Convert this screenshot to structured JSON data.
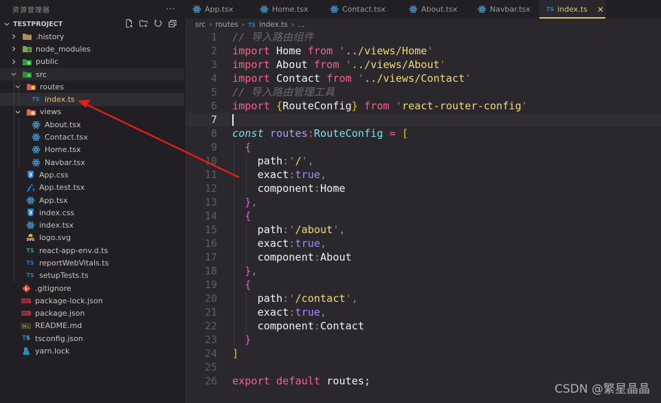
{
  "sidebar": {
    "title": "资源管理器",
    "more_label": "···",
    "project": "TESTPROJECT",
    "actions": [
      "new-file",
      "new-folder",
      "refresh",
      "collapse-all"
    ],
    "items": [
      {
        "label": ".history",
        "type": "folder",
        "icon": "folder-history-icon",
        "expanded": false,
        "depth": 1
      },
      {
        "label": "node_modules",
        "type": "folder",
        "icon": "folder-node-icon",
        "expanded": false,
        "depth": 1
      },
      {
        "label": "public",
        "type": "folder",
        "icon": "folder-public-icon",
        "expanded": false,
        "depth": 1
      },
      {
        "label": "src",
        "type": "folder",
        "icon": "folder-src-icon",
        "expanded": true,
        "depth": 1
      },
      {
        "label": "routes",
        "type": "folder",
        "icon": "folder-routes-icon",
        "expanded": true,
        "depth": 2
      },
      {
        "label": "index.ts",
        "type": "file",
        "icon": "typescript-icon",
        "depth": 3,
        "selected": true
      },
      {
        "label": "views",
        "type": "folder",
        "icon": "folder-views-icon",
        "expanded": true,
        "depth": 2
      },
      {
        "label": "About.tsx",
        "type": "file",
        "icon": "react-icon",
        "depth": 3
      },
      {
        "label": "Contact.tsx",
        "type": "file",
        "icon": "react-icon",
        "depth": 3
      },
      {
        "label": "Home.tsx",
        "type": "file",
        "icon": "react-icon",
        "depth": 3
      },
      {
        "label": "Navbar.tsx",
        "type": "file",
        "icon": "react-icon",
        "depth": 3
      },
      {
        "label": "App.css",
        "type": "file",
        "icon": "css-icon",
        "depth": 2
      },
      {
        "label": "App.test.tsx",
        "type": "file",
        "icon": "test-icon",
        "depth": 2
      },
      {
        "label": "App.tsx",
        "type": "file",
        "icon": "react-icon",
        "depth": 2
      },
      {
        "label": "index.css",
        "type": "file",
        "icon": "css-icon",
        "depth": 2
      },
      {
        "label": "index.tsx",
        "type": "file",
        "icon": "react-icon",
        "depth": 2
      },
      {
        "label": "logo.svg",
        "type": "file",
        "icon": "svg-icon",
        "depth": 2
      },
      {
        "label": "react-app-env.d.ts",
        "type": "file",
        "icon": "typescript-def-icon",
        "depth": 2
      },
      {
        "label": "reportWebVitals.ts",
        "type": "file",
        "icon": "typescript-icon",
        "depth": 2
      },
      {
        "label": "setupTests.ts",
        "type": "file",
        "icon": "typescript-icon",
        "depth": 2
      },
      {
        "label": ".gitignore",
        "type": "file",
        "icon": "git-icon",
        "depth": 1
      },
      {
        "label": "package-lock.json",
        "type": "file",
        "icon": "npm-icon",
        "depth": 1
      },
      {
        "label": "package.json",
        "type": "file",
        "icon": "npm-icon",
        "depth": 1
      },
      {
        "label": "README.md",
        "type": "file",
        "icon": "markdown-icon",
        "depth": 1
      },
      {
        "label": "tsconfig.json",
        "type": "file",
        "icon": "tsconfig-icon",
        "depth": 1
      },
      {
        "label": "yarn.lock",
        "type": "file",
        "icon": "yarn-icon",
        "depth": 1
      }
    ]
  },
  "tabs": [
    {
      "label": "App.tsx",
      "icon": "react-icon",
      "active": false
    },
    {
      "label": "Home.tsx",
      "icon": "react-icon",
      "active": false
    },
    {
      "label": "Contact.tsx",
      "icon": "react-icon",
      "active": false
    },
    {
      "label": "About.tsx",
      "icon": "react-icon",
      "active": false
    },
    {
      "label": "Navbar.tsx",
      "icon": "react-icon",
      "active": false
    },
    {
      "label": "index.ts",
      "icon": "typescript-icon",
      "active": true
    }
  ],
  "breadcrumb": {
    "parts": [
      "src",
      "routes"
    ],
    "file_badge": "TS",
    "file": "index.ts",
    "tail": "..."
  },
  "editor": {
    "current_line": 7,
    "lines": [
      [
        [
          "t-com",
          "// 导入路由组件"
        ]
      ],
      [
        [
          "t-kw",
          "import"
        ],
        [
          "t-id",
          " Home "
        ],
        [
          "t-kw",
          "from"
        ],
        [
          "t-id",
          " "
        ],
        [
          "t-q",
          "'"
        ],
        [
          "t-str",
          "../views/Home"
        ],
        [
          "t-q",
          "'"
        ]
      ],
      [
        [
          "t-kw",
          "import"
        ],
        [
          "t-id",
          " About "
        ],
        [
          "t-kw",
          "from"
        ],
        [
          "t-id",
          " "
        ],
        [
          "t-q",
          "'"
        ],
        [
          "t-str",
          "../views/About"
        ],
        [
          "t-q",
          "'"
        ]
      ],
      [
        [
          "t-kw",
          "import"
        ],
        [
          "t-id",
          " Contact "
        ],
        [
          "t-kw",
          "from"
        ],
        [
          "t-id",
          " "
        ],
        [
          "t-q",
          "'"
        ],
        [
          "t-str",
          "../views/Contact"
        ],
        [
          "t-q",
          "'"
        ]
      ],
      [
        [
          "t-com",
          "// 导入路由管理工具"
        ]
      ],
      [
        [
          "t-kw",
          "import"
        ],
        [
          "t-id",
          " "
        ],
        [
          "t-br",
          "{"
        ],
        [
          "t-id",
          "RouteConfig"
        ],
        [
          "t-br",
          "}"
        ],
        [
          "t-id",
          " "
        ],
        [
          "t-kw",
          "from"
        ],
        [
          "t-id",
          " "
        ],
        [
          "t-q",
          "'"
        ],
        [
          "t-str",
          "react-router-config"
        ],
        [
          "t-q",
          "'"
        ]
      ],
      [],
      [
        [
          "t-const",
          "const"
        ],
        [
          "t-id",
          " "
        ],
        [
          "t-var",
          "routes"
        ],
        [
          "t-op",
          ":"
        ],
        [
          "t-type",
          "RouteConfig"
        ],
        [
          "t-id",
          " "
        ],
        [
          "t-op",
          "="
        ],
        [
          "t-id",
          " "
        ],
        [
          "t-br",
          "["
        ]
      ],
      [
        [
          "t-id",
          "  "
        ],
        [
          "t-br2",
          "{"
        ]
      ],
      [
        [
          "t-id",
          "    path"
        ],
        [
          "t-punc",
          ":"
        ],
        [
          "t-q",
          "'"
        ],
        [
          "t-str",
          "/"
        ],
        [
          "t-q",
          "'"
        ],
        [
          "t-punc",
          ","
        ]
      ],
      [
        [
          "t-id",
          "    exact"
        ],
        [
          "t-punc",
          ":"
        ],
        [
          "t-bool",
          "true"
        ],
        [
          "t-punc",
          ","
        ]
      ],
      [
        [
          "t-id",
          "    component"
        ],
        [
          "t-punc",
          ":"
        ],
        [
          "t-id",
          "Home"
        ]
      ],
      [
        [
          "t-id",
          "  "
        ],
        [
          "t-br2",
          "}"
        ],
        [
          "t-punc",
          ","
        ]
      ],
      [
        [
          "t-id",
          "  "
        ],
        [
          "t-br2",
          "{"
        ]
      ],
      [
        [
          "t-id",
          "    path"
        ],
        [
          "t-punc",
          ":"
        ],
        [
          "t-q",
          "'"
        ],
        [
          "t-str",
          "/about"
        ],
        [
          "t-q",
          "'"
        ],
        [
          "t-punc",
          ","
        ]
      ],
      [
        [
          "t-id",
          "    exact"
        ],
        [
          "t-punc",
          ":"
        ],
        [
          "t-bool",
          "true"
        ],
        [
          "t-punc",
          ","
        ]
      ],
      [
        [
          "t-id",
          "    component"
        ],
        [
          "t-punc",
          ":"
        ],
        [
          "t-id",
          "About"
        ]
      ],
      [
        [
          "t-id",
          "  "
        ],
        [
          "t-br2",
          "}"
        ],
        [
          "t-punc",
          ","
        ]
      ],
      [
        [
          "t-id",
          "  "
        ],
        [
          "t-br2",
          "{"
        ]
      ],
      [
        [
          "t-id",
          "    path"
        ],
        [
          "t-punc",
          ":"
        ],
        [
          "t-q",
          "'"
        ],
        [
          "t-str",
          "/contact"
        ],
        [
          "t-q",
          "'"
        ],
        [
          "t-punc",
          ","
        ]
      ],
      [
        [
          "t-id",
          "    exact"
        ],
        [
          "t-punc",
          ":"
        ],
        [
          "t-bool",
          "true"
        ],
        [
          "t-punc",
          ","
        ]
      ],
      [
        [
          "t-id",
          "    component"
        ],
        [
          "t-punc",
          ":"
        ],
        [
          "t-id",
          "Contact"
        ]
      ],
      [
        [
          "t-id",
          "  "
        ],
        [
          "t-br2",
          "}"
        ]
      ],
      [
        [
          "t-br",
          "]"
        ]
      ],
      [],
      [
        [
          "t-kw",
          "export"
        ],
        [
          "t-id",
          " "
        ],
        [
          "t-kw",
          "default"
        ],
        [
          "t-id",
          " routes;"
        ]
      ]
    ]
  },
  "annotation": {
    "type": "red-arrow",
    "points_to": "index.ts",
    "color": "#e41b1b"
  },
  "watermark": "CSDN @繁星晶晶"
}
